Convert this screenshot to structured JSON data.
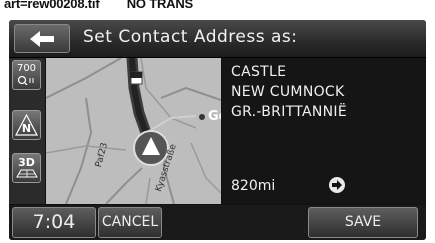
{
  "caption": "art=rew00208.tif        NO TRANS",
  "header": {
    "back_icon": "left-arrow-icon",
    "title": "Set Contact Address as:"
  },
  "tools": {
    "scale_value": "700",
    "compass_label": "N",
    "view_mode_label": "3D"
  },
  "map": {
    "street_labels": [
      "Paf23",
      "Kyasstraße"
    ],
    "place_label": "Ge"
  },
  "destination": {
    "address_lines": [
      "CASTLE",
      "NEW CUMNOCK",
      "GR.-BRITTANNIË"
    ],
    "distance": "820mi",
    "go_icon": "arrow-right-circle-icon"
  },
  "footer": {
    "clock": "7:04",
    "cancel_label": "CANCEL",
    "save_label": "SAVE"
  }
}
